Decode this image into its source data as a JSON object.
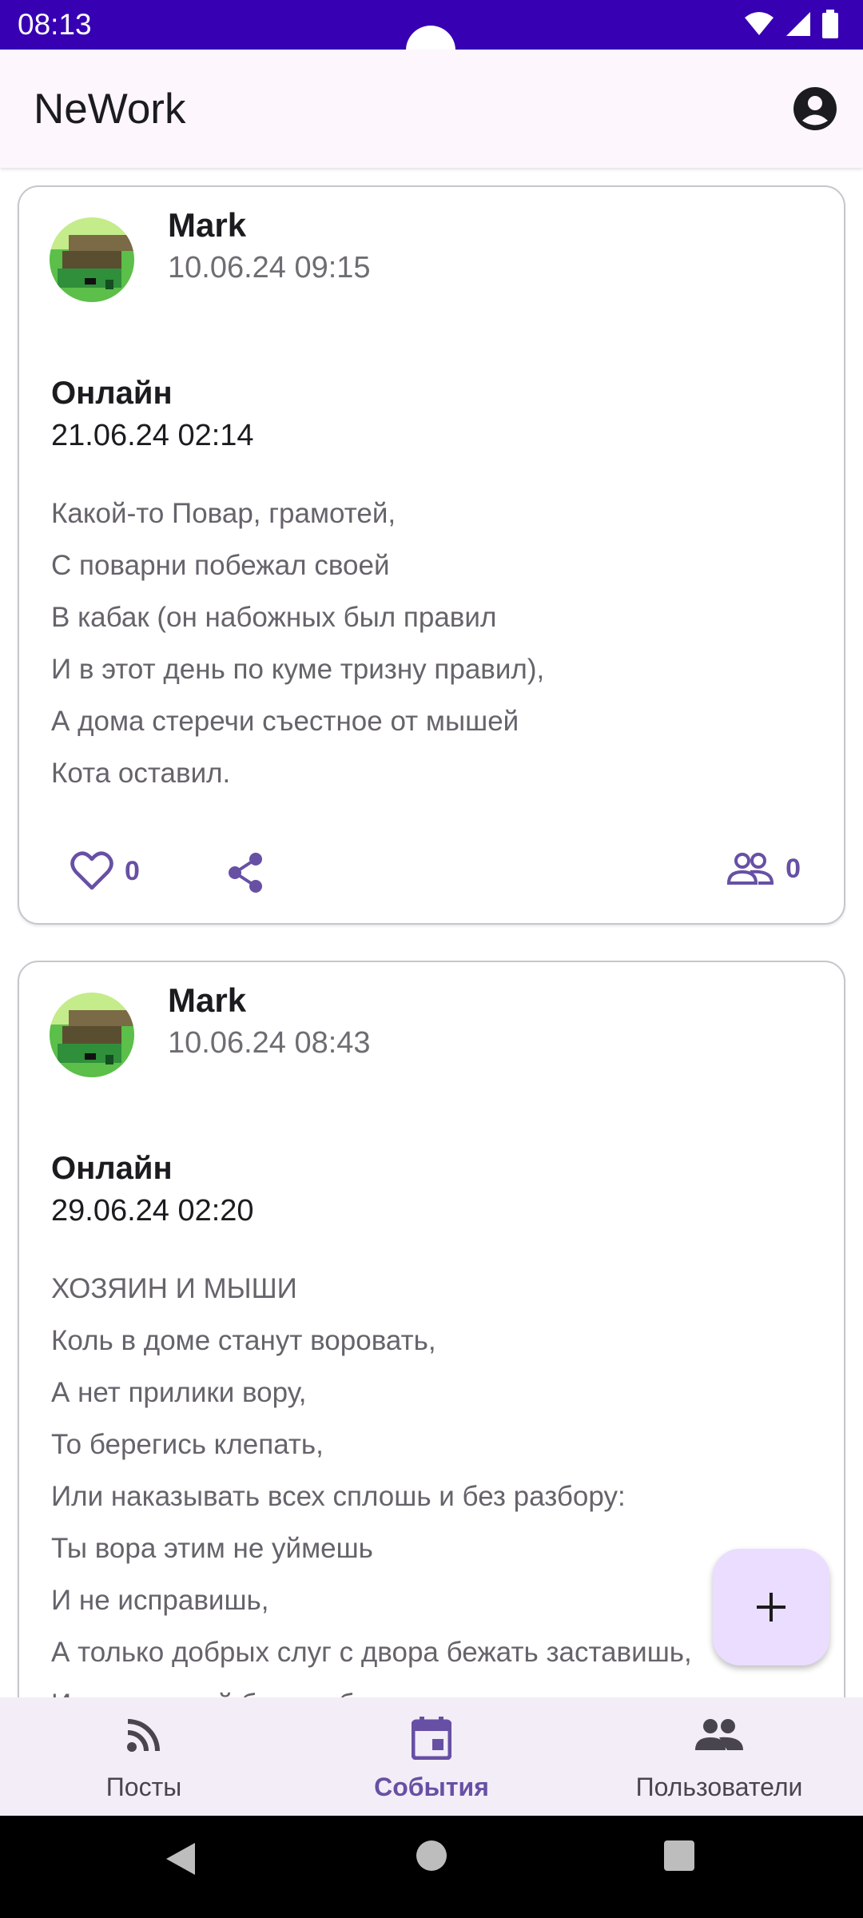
{
  "status_bar": {
    "time": "08:13"
  },
  "app_bar": {
    "title": "NeWork"
  },
  "events": [
    {
      "author": "Mark",
      "published": "10.06.24 09:15",
      "type": "Онлайн",
      "datetime": "21.06.24 02:14",
      "content": [
        "Какой-то Повар, грамотей,",
        "С поварни побежал своей",
        "В кабак (он набожных был правил",
        "И в этот день по куме тризну правил),",
        "А дома стеречи съестное от мышей",
        "Кота оставил."
      ],
      "likes": "0",
      "participants": "0"
    },
    {
      "author": "Mark",
      "published": "10.06.24 08:43",
      "type": "Онлайн",
      "datetime": "29.06.24 02:20",
      "content": [
        "ХОЗЯИН И МЫШИ",
        "Коль в доме станут воровать,",
        "А нет прилики вору,",
        "То берегись клепать,",
        "Или наказывать всех сплошь и без разбору:",
        "Ты вора этим не уймешь",
        "И не исправишь,",
        "А только добрых слуг с двора бежать заставишь,",
        "И от меньшей беды в большую попадешь."
      ]
    }
  ],
  "bottom_nav": {
    "posts": "Посты",
    "events": "События",
    "users": "Пользователи"
  },
  "colors": {
    "accent": "#6750a4",
    "status_bar": "#3700b3",
    "fab": "#eaddff",
    "nav_bg": "#f3edf7"
  },
  "icons": [
    "account-icon",
    "heart-icon",
    "share-icon",
    "participants-icon",
    "add-icon",
    "rss-icon",
    "calendar-icon",
    "people-icon"
  ]
}
